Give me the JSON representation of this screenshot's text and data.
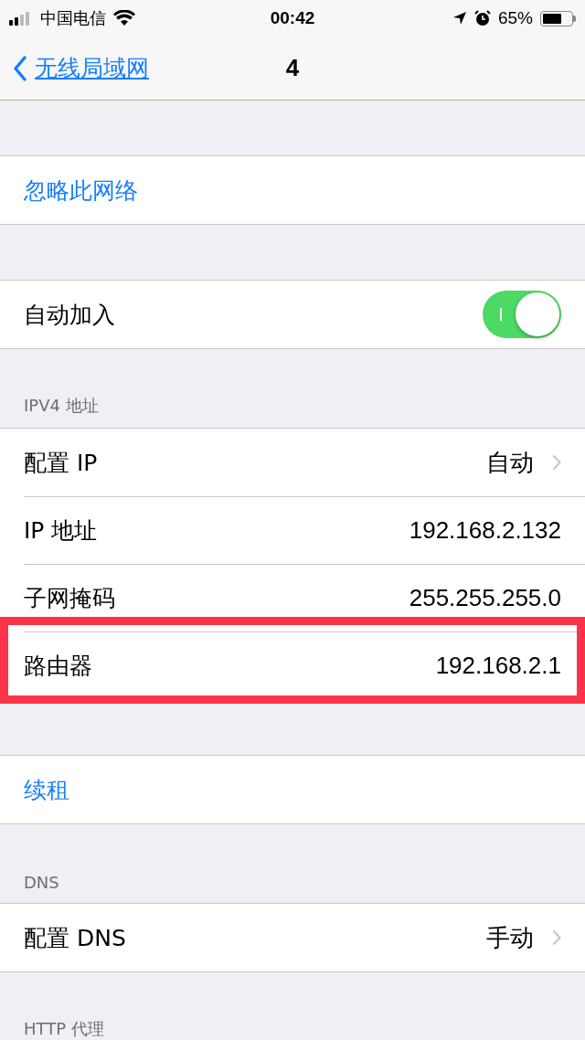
{
  "status_bar": {
    "carrier": "中国电信",
    "time": "00:42",
    "battery": "65%"
  },
  "nav": {
    "back": "无线局域网",
    "title": "4"
  },
  "sections": [
    {
      "rows": [
        {
          "kind": "action",
          "label": "忽略此网络",
          "highlighted": false
        }
      ]
    },
    {
      "rows": [
        {
          "kind": "toggle",
          "label": "自动加入",
          "on": true,
          "highlighted": false
        }
      ]
    },
    {
      "header": "IPV4 地址",
      "rows": [
        {
          "kind": "value",
          "label": "配置 IP",
          "value": "自动",
          "chevron": true,
          "highlighted": false
        },
        {
          "kind": "value",
          "label": "IP 地址",
          "value": "192.168.2.132",
          "chevron": false,
          "highlighted": false
        },
        {
          "kind": "value",
          "label": "子网掩码",
          "value": "255.255.255.0",
          "chevron": false,
          "highlighted": false
        },
        {
          "kind": "value",
          "label": "路由器",
          "value": "192.168.2.1",
          "chevron": false,
          "highlighted": true
        }
      ]
    },
    {
      "rows": [
        {
          "kind": "action",
          "label": "续租",
          "highlighted": false
        }
      ]
    },
    {
      "header": "DNS",
      "rows": [
        {
          "kind": "value",
          "label": "配置 DNS",
          "value": "手动",
          "chevron": true,
          "highlighted": false
        }
      ]
    },
    {
      "header": "HTTP 代理"
    }
  ]
}
